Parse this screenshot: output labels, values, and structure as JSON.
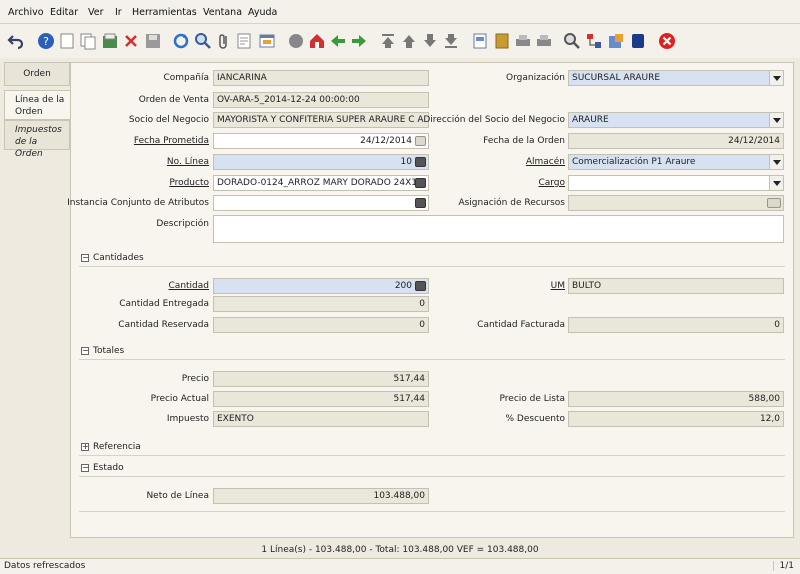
{
  "menu": [
    "Archivo",
    "Editar",
    "Ver",
    "Ir",
    "Herramientas",
    "Ventana",
    "Ayuda"
  ],
  "tabs": [
    "Orden",
    "Línea de la Orden",
    "Impuestos de la Orden"
  ],
  "form": {
    "compania": {
      "label": "Compañía",
      "value": "IANCARINA"
    },
    "organizacion": {
      "label": "Organización",
      "value": "SUCURSAL ARAURE"
    },
    "orden_venta": {
      "label": "Orden de Venta",
      "value": "OV-ARA-5_2014-12-24 00:00:00"
    },
    "socio": {
      "label": "Socio del Negocio",
      "value": "MAYORISTA Y CONFITERIA SUPER ARAURE  C A"
    },
    "direccion": {
      "label": "Dirección del Socio del Negocio",
      "value": "ARAURE"
    },
    "fecha_prometida": {
      "label": "Fecha Prometida",
      "value": "24/12/2014"
    },
    "fecha_orden": {
      "label": "Fecha de la Orden",
      "value": "24/12/2014"
    },
    "no_linea": {
      "label": "No. Línea",
      "value": "10"
    },
    "almacen": {
      "label": "Almacén",
      "value": "Comercialización P1 Araure"
    },
    "producto": {
      "label": "Producto",
      "value": "DORADO-0124_ARROZ MARY DORADO 24X1"
    },
    "cargo": {
      "label": "Cargo",
      "value": ""
    },
    "instancia": {
      "label": "Instancia Conjunto de Atributos",
      "value": ""
    },
    "asignacion": {
      "label": "Asignación de Recursos",
      "value": ""
    },
    "descripcion": {
      "label": "Descripción",
      "value": ""
    }
  },
  "sections": {
    "cantidades": "Cantidades",
    "totales": "Totales",
    "referencia": "Referencia",
    "estado": "Estado"
  },
  "cantidades": {
    "cantidad": {
      "label": "Cantidad",
      "value": "200"
    },
    "um": {
      "label": "UM",
      "value": "BULTO"
    },
    "entregada": {
      "label": "Cantidad Entregada",
      "value": "0"
    },
    "reservada": {
      "label": "Cantidad Reservada",
      "value": "0"
    },
    "facturada": {
      "label": "Cantidad Facturada",
      "value": "0"
    }
  },
  "totales": {
    "precio": {
      "label": "Precio",
      "value": "517,44"
    },
    "precio_actual": {
      "label": "Precio Actual",
      "value": "517,44"
    },
    "precio_lista": {
      "label": "Precio de Lista",
      "value": "588,00"
    },
    "impuesto": {
      "label": "Impuesto",
      "value": "EXENTO"
    },
    "descuento": {
      "label": "% Descuento",
      "value": "12,0"
    }
  },
  "estado": {
    "neto": {
      "label": "Neto de Línea",
      "value": "103.488,00"
    }
  },
  "summary": "1 Línea(s) - 103.488,00 -  Total: 103.488,00  VEF =  103.488,00",
  "status": {
    "message": "Datos refrescados",
    "page": "1/1"
  }
}
